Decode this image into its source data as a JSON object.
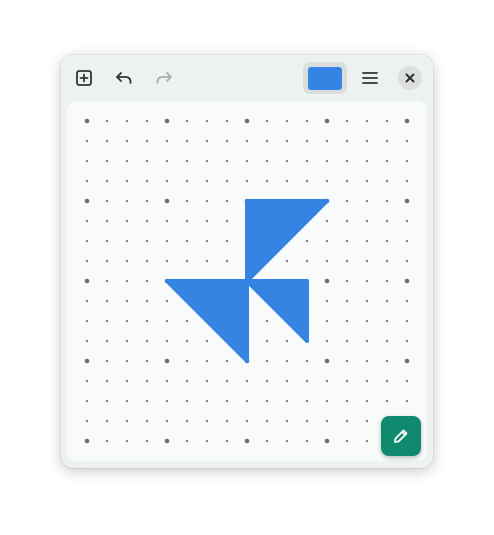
{
  "colors": {
    "window_bg": "#edf2f0",
    "canvas_bg": "#f9fbfa",
    "shape_fill": "#3584e4",
    "fab_bg": "#108a6f",
    "dot": "#888888",
    "dot_major": "#6e6e6e"
  },
  "header": {
    "new_icon": "plus-square-icon",
    "undo_icon": "undo-arrow-icon",
    "redo_icon": "redo-arrow-icon",
    "redo_enabled": false,
    "color_icon": "color-swatch",
    "selected_color": "#3584e4",
    "menu_icon": "hamburger-menu-icon",
    "close_icon": "close-x-icon"
  },
  "canvas": {
    "grid_columns": 17,
    "grid_rows": 17,
    "major_every": 4,
    "shapes": [
      {
        "type": "triangle",
        "points": [
          [
            8,
            4
          ],
          [
            12,
            4
          ],
          [
            8,
            8
          ]
        ]
      },
      {
        "type": "triangle",
        "points": [
          [
            8,
            8
          ],
          [
            11,
            8
          ],
          [
            11,
            11
          ]
        ]
      },
      {
        "type": "triangle",
        "points": [
          [
            4,
            8
          ],
          [
            8,
            8
          ],
          [
            8,
            12
          ]
        ]
      }
    ]
  },
  "fab": {
    "icon": "pencil-icon",
    "mode": "draw"
  }
}
